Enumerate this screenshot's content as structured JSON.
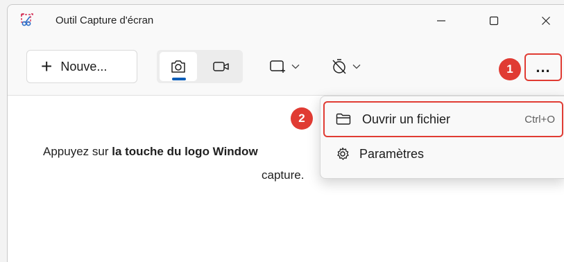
{
  "window": {
    "title": "Outil Capture d'écran"
  },
  "toolbar": {
    "new_plus": "+",
    "new_label": "Nouve...",
    "more_label": "..."
  },
  "badges": {
    "one": "1",
    "two": "2"
  },
  "menu": {
    "items": [
      {
        "label": "Ouvrir un fichier",
        "shortcut": "Ctrl+O",
        "icon": "folder-icon"
      },
      {
        "label": "Paramètres",
        "icon": "gear-icon"
      }
    ]
  },
  "content": {
    "hint_prefix": "Appuyez sur ",
    "hint_bold": "la touche du logo Window",
    "hint_line2": "capture."
  },
  "colors": {
    "accent": "#0a5db8",
    "annotation": "#e03b33"
  }
}
